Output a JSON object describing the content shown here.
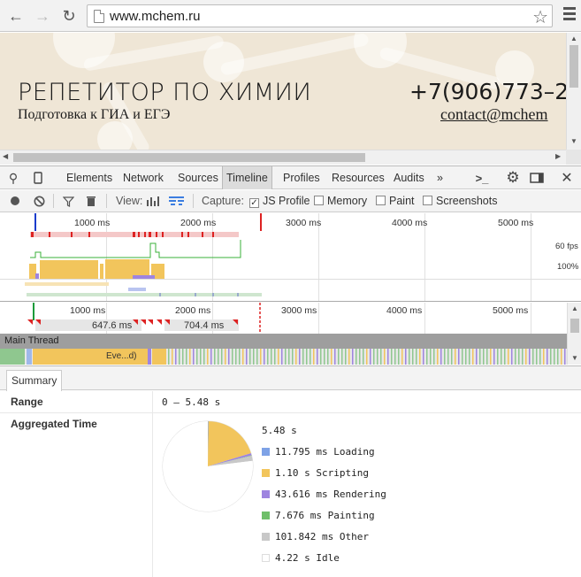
{
  "browser": {
    "url": "www.mchem.ru",
    "back_icon": "arrow-left",
    "forward_icon": "arrow-right",
    "reload_icon": "reload",
    "star_icon": "star-outline",
    "menu_icon": "hamburger"
  },
  "site": {
    "title": "РЕПЕТИТОР ПО ХИМИИ",
    "subtitle": "Подготовка к ГИА и ЕГЭ",
    "phone": "+7(906)773–2",
    "email": "contact@mchem",
    "background_color": "#efe6d6"
  },
  "devtools": {
    "tabs": [
      "Elements",
      "Network",
      "Sources",
      "Timeline",
      "Profiles",
      "Resources",
      "Audits"
    ],
    "active_tab": "Timeline",
    "more_tabs": "»"
  },
  "timeline_toolbar": {
    "view_label": "View:",
    "capture_label": "Capture:",
    "options": [
      {
        "label": "JS Profile",
        "checked": true
      },
      {
        "label": "Memory",
        "checked": false
      },
      {
        "label": "Paint",
        "checked": false
      },
      {
        "label": "Screenshots",
        "checked": false
      }
    ]
  },
  "overview": {
    "ticks": [
      "1000 ms",
      "2000 ms",
      "3000 ms",
      "4000 ms",
      "5000 ms"
    ],
    "fps_label": "60 fps",
    "percent_label": "100%"
  },
  "flame": {
    "ticks": [
      "1000 ms",
      "2000 ms",
      "3000 ms",
      "4000 ms",
      "5000 ms"
    ],
    "frame_durations": [
      "647.6 ms",
      "704.4 ms"
    ],
    "main_thread_label": "Main Thread",
    "event_label": "Eve...d)"
  },
  "summary": {
    "tab_label": "Summary",
    "range_label": "Range",
    "range_value": "0 – 5.48 s",
    "aggregated_label": "Aggregated Time",
    "total": "5.48 s",
    "categories": [
      {
        "label": "11.795 ms Loading",
        "color": "#7ea2e6",
        "value_ms": 11.795
      },
      {
        "label": "1.10 s Scripting",
        "color": "#f2c55c",
        "value_ms": 1100
      },
      {
        "label": "43.616 ms Rendering",
        "color": "#9e84e0",
        "value_ms": 43.616
      },
      {
        "label": "7.676 ms Painting",
        "color": "#6fbf6a",
        "value_ms": 7.676
      },
      {
        "label": "101.842 ms Other",
        "color": "#c8c8c8",
        "value_ms": 101.842
      },
      {
        "label": "4.22 s Idle",
        "color": "#ffffff",
        "value_ms": 4220
      }
    ]
  }
}
